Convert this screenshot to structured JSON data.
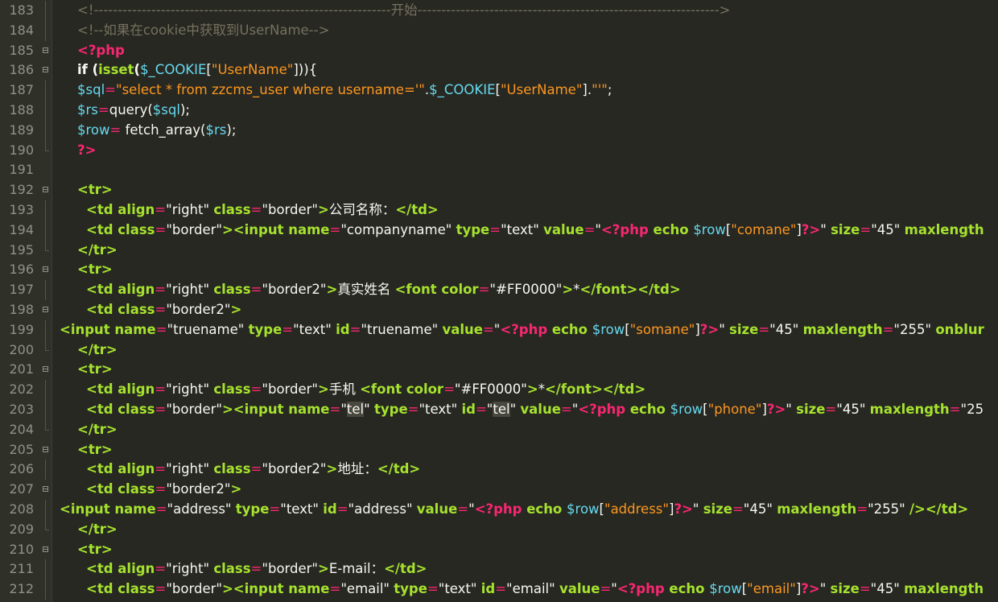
{
  "lines": [
    {
      "n": "183",
      "fold": "bar",
      "indent": 96,
      "tokens": [
        [
          "c-cmt",
          "<!--------------------------------------------------------------开始--------------------------------------------------------------->"
        ]
      ]
    },
    {
      "n": "184",
      "fold": "bar",
      "indent": 96,
      "tokens": [
        [
          "c-cmt",
          "<!--如果在cookie中获取到UserName-->"
        ]
      ]
    },
    {
      "n": "185",
      "fold": "box",
      "indent": 96,
      "tokens": [
        [
          "c-php",
          "<?php"
        ]
      ]
    },
    {
      "n": "186",
      "fold": "box",
      "indent": 96,
      "tokens": [
        [
          "c-bold",
          "if ("
        ],
        [
          "c-fn",
          "isset"
        ],
        [
          "c-bold",
          "("
        ],
        [
          "c-var",
          "$_COOKIE"
        ],
        [
          "c-plain",
          "["
        ],
        [
          "c-sqlstr",
          "\"UserName\""
        ],
        [
          "c-plain",
          "])){"
        ]
      ]
    },
    {
      "n": "187",
      "fold": "bar",
      "indent": 96,
      "tokens": [
        [
          "c-var",
          "$sql"
        ],
        [
          "c-eq",
          "="
        ],
        [
          "c-sqlstr",
          "\"select * from zzcms_user where username='\""
        ],
        [
          "c-plain",
          "."
        ],
        [
          "c-var",
          "$_COOKIE"
        ],
        [
          "c-plain",
          "["
        ],
        [
          "c-sqlstr",
          "\"UserName\""
        ],
        [
          "c-plain",
          "]."
        ],
        [
          "c-sqlstr",
          "\"'\""
        ],
        [
          "c-plain",
          ";"
        ]
      ]
    },
    {
      "n": "188",
      "fold": "bar",
      "indent": 96,
      "tokens": [
        [
          "c-var",
          "$rs"
        ],
        [
          "c-eq",
          "="
        ],
        [
          "c-plain",
          "query("
        ],
        [
          "c-var",
          "$sql"
        ],
        [
          "c-plain",
          ");"
        ]
      ]
    },
    {
      "n": "189",
      "fold": "bar",
      "indent": 96,
      "tokens": [
        [
          "c-var",
          "$row"
        ],
        [
          "c-eq",
          "="
        ],
        [
          "c-plain",
          " fetch_array("
        ],
        [
          "c-var",
          "$rs"
        ],
        [
          "c-plain",
          ");"
        ]
      ]
    },
    {
      "n": "190",
      "fold": "end",
      "indent": 96,
      "tokens": [
        [
          "c-php",
          "?>"
        ]
      ]
    },
    {
      "n": "191",
      "fold": "",
      "indent": 96,
      "tokens": []
    },
    {
      "n": "192",
      "fold": "box",
      "indent": 96,
      "tokens": [
        [
          "c-tag",
          "<tr>"
        ]
      ]
    },
    {
      "n": "193",
      "fold": "bar",
      "indent": 107,
      "tokens": [
        [
          "c-tag",
          "<td "
        ],
        [
          "c-attr",
          "align"
        ],
        [
          "c-eq",
          "="
        ],
        [
          "c-plain",
          "\"right\" "
        ],
        [
          "c-attr",
          "class"
        ],
        [
          "c-eq",
          "="
        ],
        [
          "c-plain",
          "\"border\""
        ],
        [
          "c-tag",
          ">"
        ],
        [
          "c-plain",
          "公司名称："
        ],
        [
          "c-tag",
          "</td>"
        ]
      ]
    },
    {
      "n": "194",
      "fold": "bar",
      "indent": 107,
      "tokens": [
        [
          "c-tag",
          "<td "
        ],
        [
          "c-attr",
          "class"
        ],
        [
          "c-eq",
          "="
        ],
        [
          "c-plain",
          "\"border\""
        ],
        [
          "c-tag",
          "><input "
        ],
        [
          "c-attr",
          "name"
        ],
        [
          "c-eq",
          "="
        ],
        [
          "c-plain",
          "\"companyname\" "
        ],
        [
          "c-attr",
          "type"
        ],
        [
          "c-eq",
          "="
        ],
        [
          "c-plain",
          "\"text\" "
        ],
        [
          "c-attr",
          "value"
        ],
        [
          "c-eq",
          "="
        ],
        [
          "c-plain",
          "\""
        ],
        [
          "c-php",
          "<?php "
        ],
        [
          "c-fn",
          "echo "
        ],
        [
          "c-var",
          "$row"
        ],
        [
          "c-plain",
          "["
        ],
        [
          "c-sqlstr",
          "\"comane\""
        ],
        [
          "c-plain",
          "]"
        ],
        [
          "c-php",
          "?>"
        ],
        [
          "c-plain",
          "\" "
        ],
        [
          "c-attr",
          "size"
        ],
        [
          "c-eq",
          "="
        ],
        [
          "c-plain",
          "\"45\" "
        ],
        [
          "c-attr",
          "maxlength"
        ]
      ]
    },
    {
      "n": "195",
      "fold": "end",
      "indent": 96,
      "tokens": [
        [
          "c-tag",
          "</tr>"
        ]
      ]
    },
    {
      "n": "196",
      "fold": "box",
      "indent": 96,
      "tokens": [
        [
          "c-tag",
          "<tr>"
        ]
      ]
    },
    {
      "n": "197",
      "fold": "bar",
      "indent": 107,
      "tokens": [
        [
          "c-tag",
          "<td "
        ],
        [
          "c-attr",
          "align"
        ],
        [
          "c-eq",
          "="
        ],
        [
          "c-plain",
          "\"right\" "
        ],
        [
          "c-attr",
          "class"
        ],
        [
          "c-eq",
          "="
        ],
        [
          "c-plain",
          "\"border2\""
        ],
        [
          "c-tag",
          ">"
        ],
        [
          "c-plain",
          "真实姓名 "
        ],
        [
          "c-tag",
          "<font "
        ],
        [
          "c-attr",
          "color"
        ],
        [
          "c-eq",
          "="
        ],
        [
          "c-plain",
          "\"#FF0000\""
        ],
        [
          "c-tag",
          ">"
        ],
        [
          "c-plain",
          "*"
        ],
        [
          "c-tag",
          "</font></td>"
        ]
      ]
    },
    {
      "n": "198",
      "fold": "box",
      "indent": 107,
      "tokens": [
        [
          "c-tag",
          "<td "
        ],
        [
          "c-attr",
          "class"
        ],
        [
          "c-eq",
          "="
        ],
        [
          "c-plain",
          "\"border2\""
        ],
        [
          "c-tag",
          ">"
        ]
      ]
    },
    {
      "n": "199",
      "fold": "bar",
      "indent": 74,
      "tokens": [
        [
          "c-tag",
          "<input "
        ],
        [
          "c-attr",
          "name"
        ],
        [
          "c-eq",
          "="
        ],
        [
          "c-plain",
          "\"truename\" "
        ],
        [
          "c-attr",
          "type"
        ],
        [
          "c-eq",
          "="
        ],
        [
          "c-plain",
          "\"text\" "
        ],
        [
          "c-attr",
          "id"
        ],
        [
          "c-eq",
          "="
        ],
        [
          "c-plain",
          "\"truename\" "
        ],
        [
          "c-attr",
          "value"
        ],
        [
          "c-eq",
          "="
        ],
        [
          "c-plain",
          "\""
        ],
        [
          "c-php",
          "<?php "
        ],
        [
          "c-fn",
          "echo "
        ],
        [
          "c-var",
          "$row"
        ],
        [
          "c-plain",
          "["
        ],
        [
          "c-sqlstr",
          "\"somane\""
        ],
        [
          "c-plain",
          "]"
        ],
        [
          "c-php",
          "?>"
        ],
        [
          "c-plain",
          "\" "
        ],
        [
          "c-attr",
          "size"
        ],
        [
          "c-eq",
          "="
        ],
        [
          "c-plain",
          "\"45\" "
        ],
        [
          "c-attr",
          "maxlength"
        ],
        [
          "c-eq",
          "="
        ],
        [
          "c-plain",
          "\"255\" "
        ],
        [
          "c-attr",
          "onblur"
        ]
      ]
    },
    {
      "n": "200",
      "fold": "end",
      "indent": 96,
      "tokens": [
        [
          "c-tag",
          "</tr>"
        ]
      ]
    },
    {
      "n": "201",
      "fold": "box",
      "indent": 96,
      "tokens": [
        [
          "c-tag",
          "<tr>"
        ]
      ]
    },
    {
      "n": "202",
      "fold": "bar",
      "indent": 107,
      "tokens": [
        [
          "c-tag",
          "<td "
        ],
        [
          "c-attr",
          "align"
        ],
        [
          "c-eq",
          "="
        ],
        [
          "c-plain",
          "\"right\" "
        ],
        [
          "c-attr",
          "class"
        ],
        [
          "c-eq",
          "="
        ],
        [
          "c-plain",
          "\"border\""
        ],
        [
          "c-tag",
          ">"
        ],
        [
          "c-plain",
          "手机 "
        ],
        [
          "c-tag",
          "<font "
        ],
        [
          "c-attr",
          "color"
        ],
        [
          "c-eq",
          "="
        ],
        [
          "c-plain",
          "\"#FF0000\""
        ],
        [
          "c-tag",
          ">"
        ],
        [
          "c-plain",
          "*"
        ],
        [
          "c-tag",
          "</font></td>"
        ]
      ]
    },
    {
      "n": "203",
      "fold": "bar",
      "indent": 107,
      "tokens": [
        [
          "c-tag",
          "<td "
        ],
        [
          "c-attr",
          "class"
        ],
        [
          "c-eq",
          "="
        ],
        [
          "c-plain",
          "\"border\""
        ],
        [
          "c-tag",
          "><input "
        ],
        [
          "c-attr",
          "name"
        ],
        [
          "c-eq",
          "="
        ],
        [
          "c-plain",
          "\""
        ],
        [
          "c-hl",
          "tel"
        ],
        [
          "c-plain",
          "\" "
        ],
        [
          "c-attr",
          "type"
        ],
        [
          "c-eq",
          "="
        ],
        [
          "c-plain",
          "\"text\" "
        ],
        [
          "c-attr",
          "id"
        ],
        [
          "c-eq",
          "="
        ],
        [
          "c-plain",
          "\""
        ],
        [
          "c-hl",
          "tel"
        ],
        [
          "c-plain",
          "\" "
        ],
        [
          "c-attr",
          "value"
        ],
        [
          "c-eq",
          "="
        ],
        [
          "c-plain",
          "\""
        ],
        [
          "c-php",
          "<?php "
        ],
        [
          "c-fn",
          "echo "
        ],
        [
          "c-var",
          "$row"
        ],
        [
          "c-plain",
          "["
        ],
        [
          "c-sqlstr",
          "\"phone\""
        ],
        [
          "c-plain",
          "]"
        ],
        [
          "c-php",
          "?>"
        ],
        [
          "c-plain",
          "\" "
        ],
        [
          "c-attr",
          "size"
        ],
        [
          "c-eq",
          "="
        ],
        [
          "c-plain",
          "\"45\" "
        ],
        [
          "c-attr",
          "maxlength"
        ],
        [
          "c-eq",
          "="
        ],
        [
          "c-plain",
          "\"25"
        ]
      ]
    },
    {
      "n": "204",
      "fold": "end",
      "indent": 96,
      "tokens": [
        [
          "c-tag",
          "</tr>"
        ]
      ]
    },
    {
      "n": "205",
      "fold": "box",
      "indent": 96,
      "tokens": [
        [
          "c-tag",
          "<tr>"
        ]
      ]
    },
    {
      "n": "206",
      "fold": "bar",
      "indent": 107,
      "tokens": [
        [
          "c-tag",
          "<td "
        ],
        [
          "c-attr",
          "align"
        ],
        [
          "c-eq",
          "="
        ],
        [
          "c-plain",
          "\"right\" "
        ],
        [
          "c-attr",
          "class"
        ],
        [
          "c-eq",
          "="
        ],
        [
          "c-plain",
          "\"border2\""
        ],
        [
          "c-tag",
          ">"
        ],
        [
          "c-plain",
          "地址："
        ],
        [
          "c-tag",
          "</td>"
        ]
      ]
    },
    {
      "n": "207",
      "fold": "box",
      "indent": 107,
      "tokens": [
        [
          "c-tag",
          "<td "
        ],
        [
          "c-attr",
          "class"
        ],
        [
          "c-eq",
          "="
        ],
        [
          "c-plain",
          "\"border2\""
        ],
        [
          "c-tag",
          ">"
        ]
      ]
    },
    {
      "n": "208",
      "fold": "bar",
      "indent": 74,
      "tokens": [
        [
          "c-tag",
          "<input "
        ],
        [
          "c-attr",
          "name"
        ],
        [
          "c-eq",
          "="
        ],
        [
          "c-plain",
          "\"address\" "
        ],
        [
          "c-attr",
          "type"
        ],
        [
          "c-eq",
          "="
        ],
        [
          "c-plain",
          "\"text\" "
        ],
        [
          "c-attr",
          "id"
        ],
        [
          "c-eq",
          "="
        ],
        [
          "c-plain",
          "\"address\" "
        ],
        [
          "c-attr",
          "value"
        ],
        [
          "c-eq",
          "="
        ],
        [
          "c-plain",
          "\""
        ],
        [
          "c-php",
          "<?php "
        ],
        [
          "c-fn",
          "echo "
        ],
        [
          "c-var",
          "$row"
        ],
        [
          "c-plain",
          "["
        ],
        [
          "c-sqlstr",
          "\"address\""
        ],
        [
          "c-plain",
          "]"
        ],
        [
          "c-php",
          "?>"
        ],
        [
          "c-plain",
          "\" "
        ],
        [
          "c-attr",
          "size"
        ],
        [
          "c-eq",
          "="
        ],
        [
          "c-plain",
          "\"45\" "
        ],
        [
          "c-attr",
          "maxlength"
        ],
        [
          "c-eq",
          "="
        ],
        [
          "c-plain",
          "\"255\" "
        ],
        [
          "c-tag",
          "/></td>"
        ]
      ]
    },
    {
      "n": "209",
      "fold": "end",
      "indent": 96,
      "tokens": [
        [
          "c-tag",
          "</tr>"
        ]
      ]
    },
    {
      "n": "210",
      "fold": "box",
      "indent": 96,
      "tokens": [
        [
          "c-tag",
          "<tr>"
        ]
      ]
    },
    {
      "n": "211",
      "fold": "bar",
      "indent": 107,
      "tokens": [
        [
          "c-tag",
          "<td "
        ],
        [
          "c-attr",
          "align"
        ],
        [
          "c-eq",
          "="
        ],
        [
          "c-plain",
          "\"right\" "
        ],
        [
          "c-attr",
          "class"
        ],
        [
          "c-eq",
          "="
        ],
        [
          "c-plain",
          "\"border\""
        ],
        [
          "c-tag",
          ">"
        ],
        [
          "c-plain",
          "E-mail："
        ],
        [
          "c-tag",
          "</td>"
        ]
      ]
    },
    {
      "n": "212",
      "fold": "bar",
      "indent": 107,
      "tokens": [
        [
          "c-tag",
          "<td "
        ],
        [
          "c-attr",
          "class"
        ],
        [
          "c-eq",
          "="
        ],
        [
          "c-plain",
          "\"border\""
        ],
        [
          "c-tag",
          "><input "
        ],
        [
          "c-attr",
          "name"
        ],
        [
          "c-eq",
          "="
        ],
        [
          "c-plain",
          "\"email\" "
        ],
        [
          "c-attr",
          "type"
        ],
        [
          "c-eq",
          "="
        ],
        [
          "c-plain",
          "\"text\" "
        ],
        [
          "c-attr",
          "id"
        ],
        [
          "c-eq",
          "="
        ],
        [
          "c-plain",
          "\"email\" "
        ],
        [
          "c-attr",
          "value"
        ],
        [
          "c-eq",
          "="
        ],
        [
          "c-plain",
          "\""
        ],
        [
          "c-php",
          "<?php "
        ],
        [
          "c-fn",
          "echo "
        ],
        [
          "c-var",
          "$row"
        ],
        [
          "c-plain",
          "["
        ],
        [
          "c-sqlstr",
          "\"email\""
        ],
        [
          "c-plain",
          "]"
        ],
        [
          "c-php",
          "?>"
        ],
        [
          "c-plain",
          "\" "
        ],
        [
          "c-attr",
          "size"
        ],
        [
          "c-eq",
          "="
        ],
        [
          "c-plain",
          "\"45\" "
        ],
        [
          "c-attr",
          "maxlength"
        ]
      ]
    }
  ]
}
